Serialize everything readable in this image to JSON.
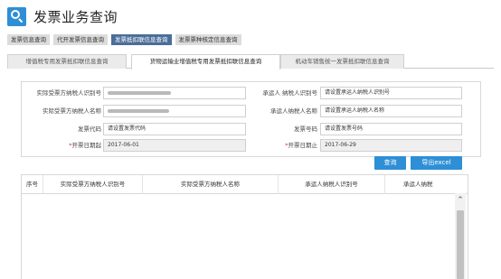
{
  "header": {
    "title": "发票业务查询"
  },
  "top_tabs": [
    {
      "label": "发票信息查询",
      "active": false
    },
    {
      "label": "代开发票信息查询",
      "active": false
    },
    {
      "label": "发票抵扣联信息查询",
      "active": true
    },
    {
      "label": "发票票种核定信息查询",
      "active": false
    }
  ],
  "sub_tabs": [
    {
      "label": "增值税专用发票抵扣联信息查询",
      "active": false
    },
    {
      "label": "货物运输业增值税专用发票抵扣联信息查询",
      "active": true
    },
    {
      "label": "机动车销售统一发票抵扣联信息查询",
      "active": false
    }
  ],
  "form": {
    "actual_recipient_taxid": {
      "label": "实际受票方纳税人识别号",
      "value": "(blurred)"
    },
    "carrier_taxid": {
      "label": "承运人 纳税人识别号",
      "placeholder": "请设置承运人纳税人识别号"
    },
    "actual_recipient_name": {
      "label": "实际受票方纳税人名称",
      "value": "(blurred)"
    },
    "carrier_name": {
      "label": "承运人纳税人名称",
      "placeholder": "请设置承运人纳税人名称"
    },
    "invoice_code": {
      "label": "发票代码",
      "placeholder": "请设置发票代码"
    },
    "invoice_number": {
      "label": "发票号码",
      "placeholder": "请设置发票号码"
    },
    "start_date": {
      "required_mark": "*",
      "label": "开票日期起",
      "value": "2017-06-01"
    },
    "end_date": {
      "required_mark": "*",
      "label": "开票日期止",
      "value": "2017-06-29"
    }
  },
  "buttons": {
    "query": "查询",
    "export": "导出excel"
  },
  "table": {
    "columns": [
      "序号",
      "实际受票方纳税人识别号",
      "实际受票方纳税人名称",
      "承运人纳税人识别号",
      "承运人纳税"
    ]
  },
  "colors": {
    "accent": "#2e8fd6",
    "active_tab": "#4a6d99",
    "required": "#e0262c"
  }
}
